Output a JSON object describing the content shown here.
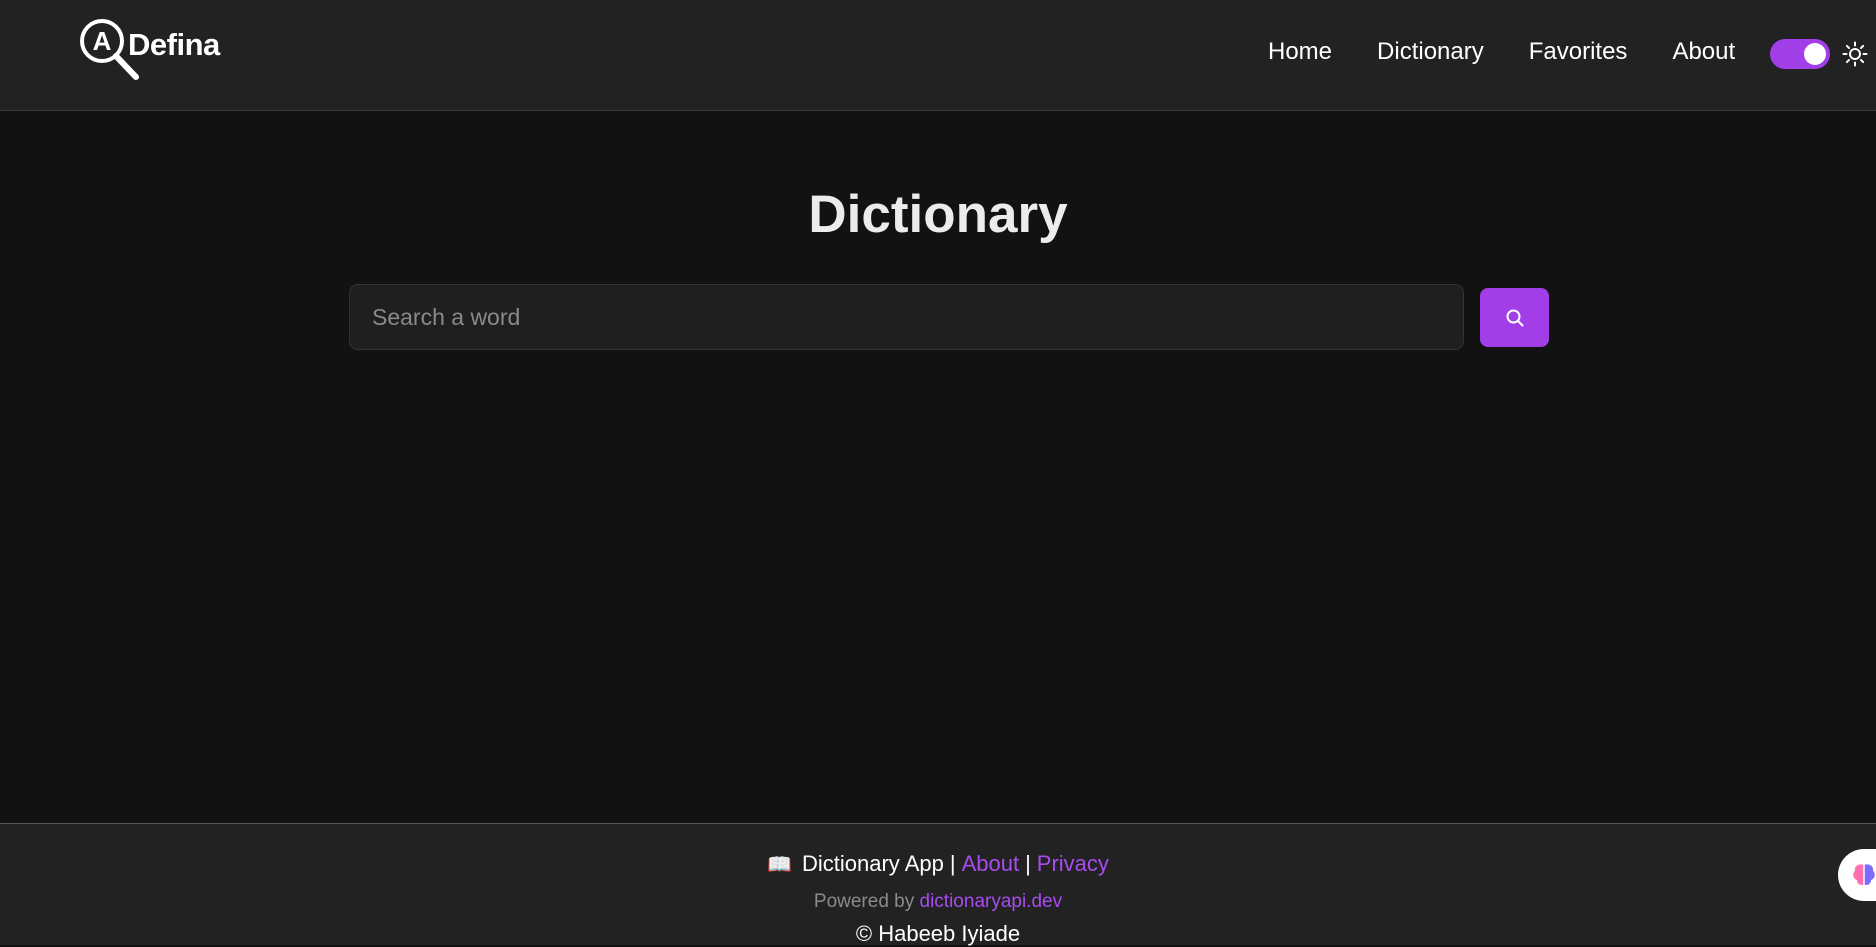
{
  "header": {
    "logo_text": "Defina",
    "nav": [
      {
        "label": "Home"
      },
      {
        "label": "Dictionary"
      },
      {
        "label": "Favorites"
      },
      {
        "label": "About"
      }
    ],
    "theme_toggle": {
      "state": "on",
      "color": "#a23ee8"
    },
    "sun_icon": "sun-icon"
  },
  "main": {
    "title": "Dictionary",
    "search": {
      "placeholder": "Search a word",
      "value": ""
    },
    "search_button_icon": "search-icon"
  },
  "footer": {
    "book_icon": "📖",
    "app_name": "Dictionary App",
    "separator": "|",
    "about_link": "About",
    "privacy_link": "Privacy",
    "powered_by": "Powered by",
    "api_link": "dictionaryapi.dev",
    "copyright": "© Habeeb Iyiade"
  },
  "colors": {
    "accent": "#a23ee8",
    "background": "#121212",
    "surface": "#222222"
  }
}
